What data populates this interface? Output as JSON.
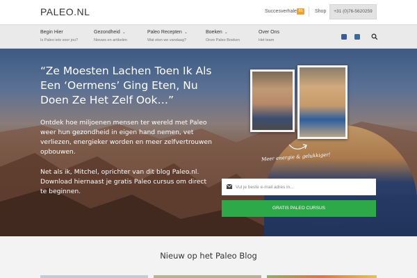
{
  "brand": {
    "logo": "PALEO.NL"
  },
  "topbar": {
    "success_label": "Succesverhalen",
    "success_count": "65",
    "shop_label": "Shop",
    "phone": "+31 (0)76-5620259"
  },
  "nav": {
    "items": [
      {
        "title": "Begin Hier",
        "sub": "Is Paleo iets voor jou?",
        "dropdown": false
      },
      {
        "title": "Gezondheid",
        "sub": "Nieuws en artikelen",
        "dropdown": true
      },
      {
        "title": "Paleo Recepten",
        "sub": "Wat eten we vandaag?",
        "dropdown": true
      },
      {
        "title": "Boeken",
        "sub": "Onze Paleo Boeken",
        "dropdown": true
      },
      {
        "title": "Over Ons",
        "sub": "Het team",
        "dropdown": false
      }
    ],
    "icons": [
      "facebook-icon",
      "instagram-icon",
      "search-icon"
    ]
  },
  "hero": {
    "title": "“Ze Moesten Lachen Toen Ik Als Een ‘Oermens’ Ging Eten, Nu Doen Ze Het Zelf Ook…”",
    "paragraph1": "Ontdek hoe miljoenen mensen ter wereld met Paleo weer hun gezondheid in eigen hand nemen, vet verliezen, energieker worden en meer zelfvertrouwen opbouwen.",
    "paragraph2": "Net als ik, Mitchel, oprichter van dit blog Paleo.nl. Download hiernaast je gratis Paleo cursus om direct te beginnen.",
    "handwritten": "Meer energie & gelukkiger!",
    "email_placeholder": "Vul je beste e-mail adres in...",
    "cta_label": "GRATIS PALEO CURSUS"
  },
  "blog": {
    "heading": "Nieuw op het Paleo Blog"
  },
  "colors": {
    "accent_green": "#2ea94a",
    "badge_orange": "#f0a12b",
    "nav_bg": "#eaeaea"
  }
}
